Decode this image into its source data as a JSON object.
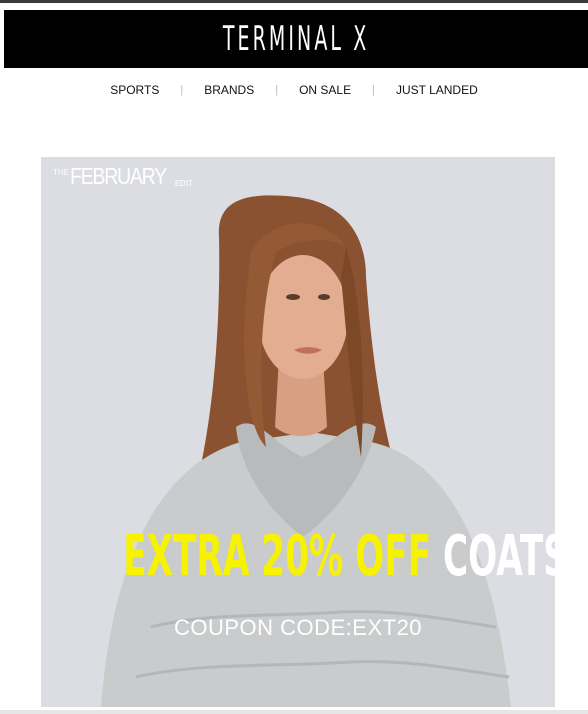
{
  "header": {
    "logo_text": "TERMINAL X"
  },
  "nav": {
    "items": [
      "SPORTS",
      "BRANDS",
      "ON SALE",
      "JUST LANDED"
    ],
    "separator": "|"
  },
  "hero": {
    "edit_prefix": "THE",
    "edit_title": "FEBRUARY",
    "edit_suffix": "EDIT",
    "headline_highlight": "EXTRA 20% OFF",
    "headline_rest": "COATS",
    "coupon": "COUPON CODE:EXT20",
    "colors": {
      "highlight": "#f6f200",
      "background": "#dcdde2"
    }
  }
}
